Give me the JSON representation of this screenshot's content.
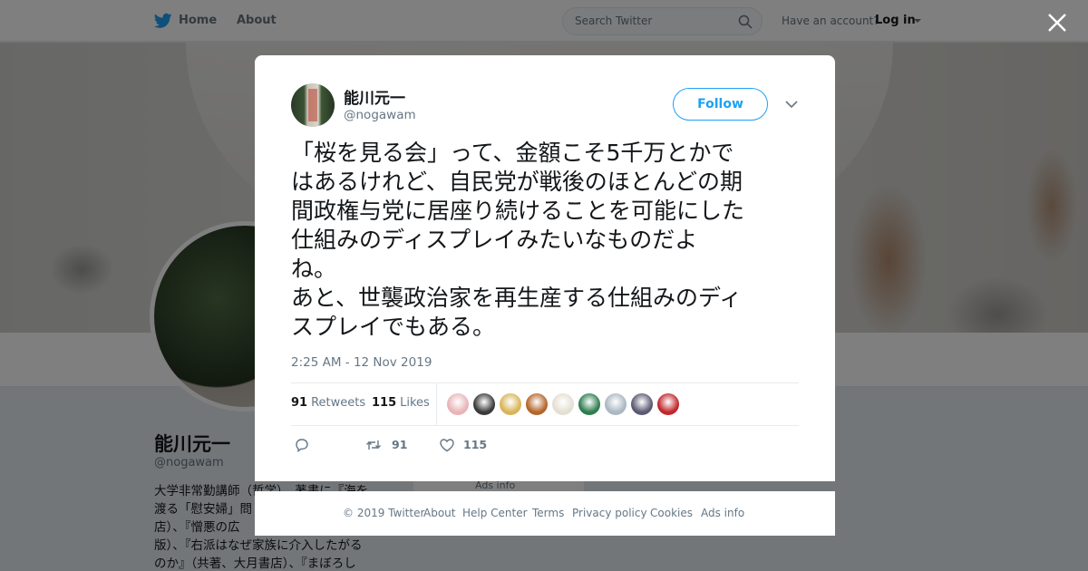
{
  "nav": {
    "home_label": "Home",
    "about_label": "About",
    "search_placeholder": "Search Twitter",
    "account_prompt": "Have an account?",
    "login_label": "Log in"
  },
  "profile": {
    "name": "能川元一",
    "handle": "@nogawam",
    "bio_lines": [
      "大学非常勤講師（哲学）。著書に『海を",
      "渡る「慰安婦」問",
      "店）、『憎悪の広",
      "版）、『右派はなぜ家族に介入したがる",
      "のか』（共著、大月書店）、『まぼろし"
    ],
    "ads_info": "Ads info"
  },
  "tweet": {
    "author_name": "能川元一",
    "author_handle": "@nogawam",
    "follow_label": "Follow",
    "text": "「桜を見る会」って、金額こそ5千万とかで\nはあるけれど、自民党が戦後のほとんどの期\n間政権与党に居座り続けることを可能にした\n仕組みのディスプレイみたいなものだよ\nね。\nあと、世襲政治家を再生産する仕組みのディ\nスプレイでもある。",
    "timestamp": "2:25 AM - 12 Nov 2019",
    "retweets_count": "91",
    "retweets_label": "Retweets",
    "likes_count": "115",
    "likes_label": "Likes",
    "actions": {
      "retweet_count": "91",
      "like_count": "115"
    },
    "likers": [
      {
        "name": "liker-1",
        "color": "#e8b4b8"
      },
      {
        "name": "liker-2",
        "color": "#3a3a3a"
      },
      {
        "name": "liker-3",
        "color": "#d9b45a"
      },
      {
        "name": "liker-4",
        "color": "#b5652b"
      },
      {
        "name": "liker-5",
        "color": "#e4dfd2"
      },
      {
        "name": "liker-6",
        "color": "#2f7d4f"
      },
      {
        "name": "liker-7",
        "color": "#aab8c2"
      },
      {
        "name": "liker-8",
        "color": "#5a5a72"
      },
      {
        "name": "liker-9",
        "color": "#c0282d"
      }
    ]
  },
  "footer": {
    "links": [
      "© 2019 Twitter",
      "About",
      "Help Center",
      "Terms",
      "Privacy policy",
      "Cookies",
      "Ads info"
    ]
  },
  "colors": {
    "brand": "#1da1f2",
    "muted": "#657786",
    "text": "#14171a"
  }
}
